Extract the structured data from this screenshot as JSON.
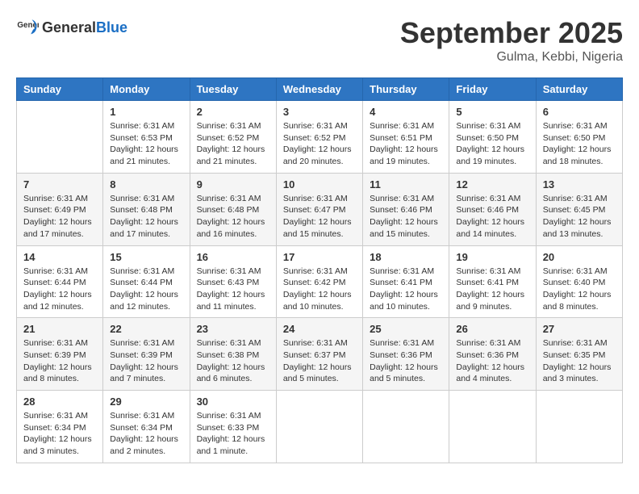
{
  "header": {
    "logo_general": "General",
    "logo_blue": "Blue",
    "month_title": "September 2025",
    "location": "Gulma, Kebbi, Nigeria"
  },
  "columns": [
    "Sunday",
    "Monday",
    "Tuesday",
    "Wednesday",
    "Thursday",
    "Friday",
    "Saturday"
  ],
  "weeks": [
    [
      {
        "day": "",
        "info": ""
      },
      {
        "day": "1",
        "info": "Sunrise: 6:31 AM\nSunset: 6:53 PM\nDaylight: 12 hours\nand 21 minutes."
      },
      {
        "day": "2",
        "info": "Sunrise: 6:31 AM\nSunset: 6:52 PM\nDaylight: 12 hours\nand 21 minutes."
      },
      {
        "day": "3",
        "info": "Sunrise: 6:31 AM\nSunset: 6:52 PM\nDaylight: 12 hours\nand 20 minutes."
      },
      {
        "day": "4",
        "info": "Sunrise: 6:31 AM\nSunset: 6:51 PM\nDaylight: 12 hours\nand 19 minutes."
      },
      {
        "day": "5",
        "info": "Sunrise: 6:31 AM\nSunset: 6:50 PM\nDaylight: 12 hours\nand 19 minutes."
      },
      {
        "day": "6",
        "info": "Sunrise: 6:31 AM\nSunset: 6:50 PM\nDaylight: 12 hours\nand 18 minutes."
      }
    ],
    [
      {
        "day": "7",
        "info": "Sunrise: 6:31 AM\nSunset: 6:49 PM\nDaylight: 12 hours\nand 17 minutes."
      },
      {
        "day": "8",
        "info": "Sunrise: 6:31 AM\nSunset: 6:48 PM\nDaylight: 12 hours\nand 17 minutes."
      },
      {
        "day": "9",
        "info": "Sunrise: 6:31 AM\nSunset: 6:48 PM\nDaylight: 12 hours\nand 16 minutes."
      },
      {
        "day": "10",
        "info": "Sunrise: 6:31 AM\nSunset: 6:47 PM\nDaylight: 12 hours\nand 15 minutes."
      },
      {
        "day": "11",
        "info": "Sunrise: 6:31 AM\nSunset: 6:46 PM\nDaylight: 12 hours\nand 15 minutes."
      },
      {
        "day": "12",
        "info": "Sunrise: 6:31 AM\nSunset: 6:46 PM\nDaylight: 12 hours\nand 14 minutes."
      },
      {
        "day": "13",
        "info": "Sunrise: 6:31 AM\nSunset: 6:45 PM\nDaylight: 12 hours\nand 13 minutes."
      }
    ],
    [
      {
        "day": "14",
        "info": "Sunrise: 6:31 AM\nSunset: 6:44 PM\nDaylight: 12 hours\nand 12 minutes."
      },
      {
        "day": "15",
        "info": "Sunrise: 6:31 AM\nSunset: 6:44 PM\nDaylight: 12 hours\nand 12 minutes."
      },
      {
        "day": "16",
        "info": "Sunrise: 6:31 AM\nSunset: 6:43 PM\nDaylight: 12 hours\nand 11 minutes."
      },
      {
        "day": "17",
        "info": "Sunrise: 6:31 AM\nSunset: 6:42 PM\nDaylight: 12 hours\nand 10 minutes."
      },
      {
        "day": "18",
        "info": "Sunrise: 6:31 AM\nSunset: 6:41 PM\nDaylight: 12 hours\nand 10 minutes."
      },
      {
        "day": "19",
        "info": "Sunrise: 6:31 AM\nSunset: 6:41 PM\nDaylight: 12 hours\nand 9 minutes."
      },
      {
        "day": "20",
        "info": "Sunrise: 6:31 AM\nSunset: 6:40 PM\nDaylight: 12 hours\nand 8 minutes."
      }
    ],
    [
      {
        "day": "21",
        "info": "Sunrise: 6:31 AM\nSunset: 6:39 PM\nDaylight: 12 hours\nand 8 minutes."
      },
      {
        "day": "22",
        "info": "Sunrise: 6:31 AM\nSunset: 6:39 PM\nDaylight: 12 hours\nand 7 minutes."
      },
      {
        "day": "23",
        "info": "Sunrise: 6:31 AM\nSunset: 6:38 PM\nDaylight: 12 hours\nand 6 minutes."
      },
      {
        "day": "24",
        "info": "Sunrise: 6:31 AM\nSunset: 6:37 PM\nDaylight: 12 hours\nand 5 minutes."
      },
      {
        "day": "25",
        "info": "Sunrise: 6:31 AM\nSunset: 6:36 PM\nDaylight: 12 hours\nand 5 minutes."
      },
      {
        "day": "26",
        "info": "Sunrise: 6:31 AM\nSunset: 6:36 PM\nDaylight: 12 hours\nand 4 minutes."
      },
      {
        "day": "27",
        "info": "Sunrise: 6:31 AM\nSunset: 6:35 PM\nDaylight: 12 hours\nand 3 minutes."
      }
    ],
    [
      {
        "day": "28",
        "info": "Sunrise: 6:31 AM\nSunset: 6:34 PM\nDaylight: 12 hours\nand 3 minutes."
      },
      {
        "day": "29",
        "info": "Sunrise: 6:31 AM\nSunset: 6:34 PM\nDaylight: 12 hours\nand 2 minutes."
      },
      {
        "day": "30",
        "info": "Sunrise: 6:31 AM\nSunset: 6:33 PM\nDaylight: 12 hours\nand 1 minute."
      },
      {
        "day": "",
        "info": ""
      },
      {
        "day": "",
        "info": ""
      },
      {
        "day": "",
        "info": ""
      },
      {
        "day": "",
        "info": ""
      }
    ]
  ]
}
